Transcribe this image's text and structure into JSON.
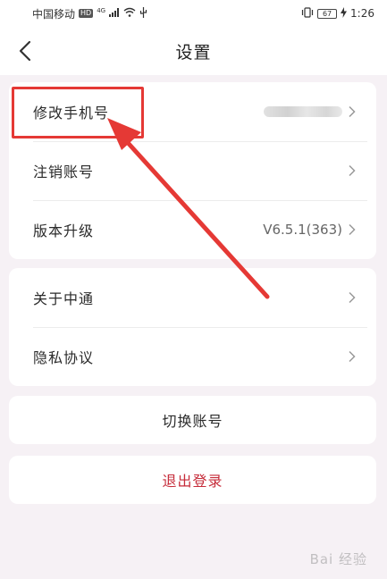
{
  "status_bar": {
    "carrier": "中国移动",
    "hd": "HD",
    "network": "4G",
    "battery": "67",
    "time": "1:26"
  },
  "header": {
    "title": "设置"
  },
  "account_card": {
    "items": [
      {
        "label": "修改手机号",
        "value": ""
      },
      {
        "label": "注销账号",
        "value": ""
      },
      {
        "label": "版本升级",
        "value": "V6.5.1(363)"
      }
    ]
  },
  "info_card": {
    "items": [
      {
        "label": "关于中通"
      },
      {
        "label": "隐私协议"
      }
    ]
  },
  "switch_account": {
    "label": "切换账号"
  },
  "logout": {
    "label": "退出登录",
    "color": "#c62c3a"
  },
  "annotation": {
    "color": "#e53935"
  },
  "watermark": {
    "text": "Bai 经验"
  }
}
